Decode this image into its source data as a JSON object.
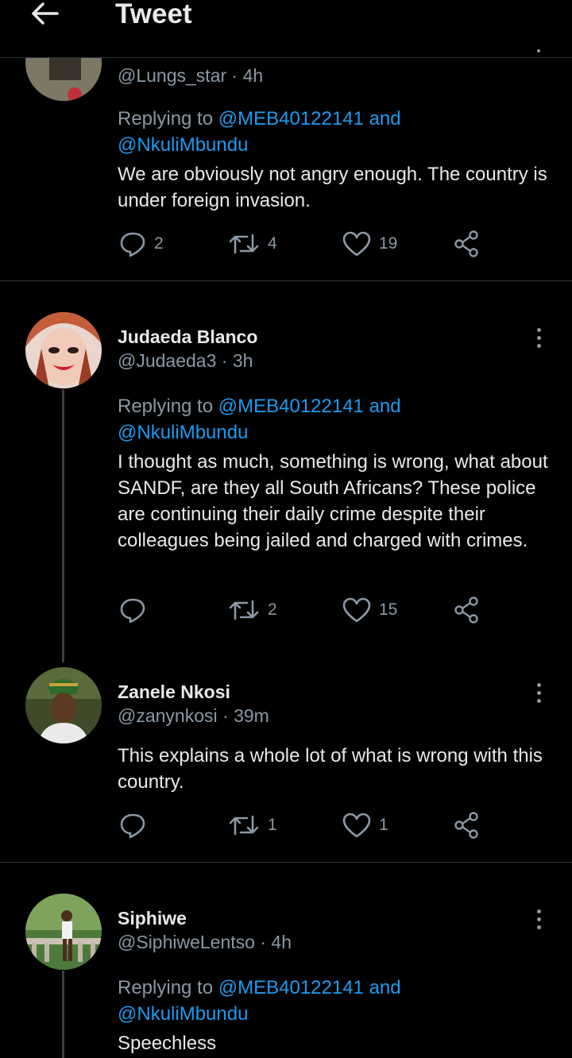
{
  "header": {
    "title": "Tweet"
  },
  "tweets": [
    {
      "name": "",
      "handle": "@Lungs_star",
      "time": "4h",
      "replying_prefix": "Replying to",
      "mention1": "@MEB40122141",
      "and": "and",
      "mention2": "@NkuliMbundu",
      "text": "We are obviously not angry enough. The country is under foreign invasion.",
      "replies": "2",
      "retweets": "4",
      "likes": "19"
    },
    {
      "name": "Judaeda Blanco",
      "handle": "@Judaeda3",
      "time": "3h",
      "replying_prefix": "Replying to",
      "mention1": "@MEB40122141",
      "and": "and",
      "mention2": "@NkuliMbundu",
      "text": "I thought as much, something is wrong, what about SANDF, are they all South Africans? These police are continuing their daily crime despite their colleagues being jailed and charged with crimes.",
      "replies": "",
      "retweets": "2",
      "likes": "15"
    },
    {
      "name": "Zanele Nkosi",
      "handle": "@zanynkosi",
      "time": "39m",
      "text": "This explains a whole lot of what is wrong with this country.",
      "replies": "",
      "retweets": "1",
      "likes": "1"
    },
    {
      "name": "Siphiwe",
      "handle": "@SiphiweLentso",
      "time": "4h",
      "replying_prefix": "Replying to",
      "mention1": "@MEB40122141",
      "and": "and",
      "mention2": "@NkuliMbundu",
      "text": "Speechless"
    }
  ],
  "colors": {
    "accent": "#1d9bf0",
    "muted": "#8b98a5",
    "text": "#e7e9ea",
    "background": "#000000"
  },
  "icons": [
    "back-arrow-icon",
    "reply-icon",
    "retweet-icon",
    "like-icon",
    "share-icon",
    "more-icon"
  ]
}
